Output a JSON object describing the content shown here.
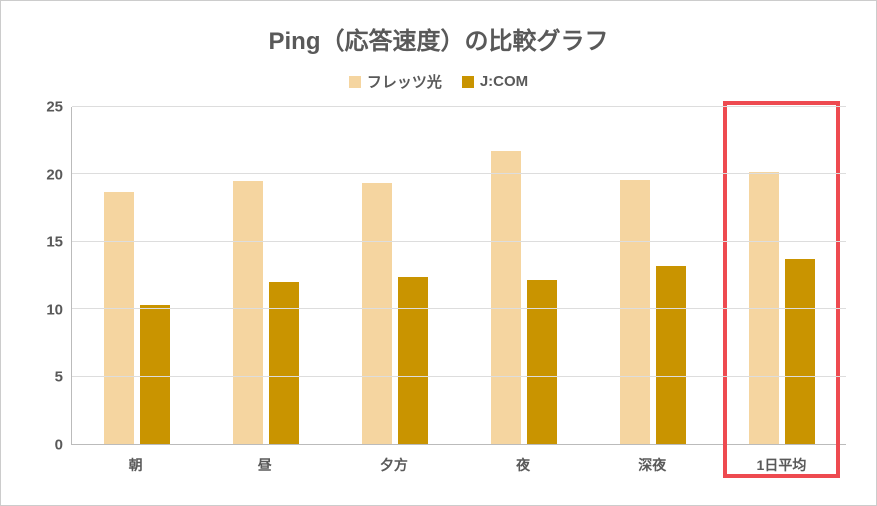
{
  "chart_data": {
    "type": "bar",
    "title": "Ping（応答速度）の比較グラフ",
    "categories": [
      "朝",
      "昼",
      "夕方",
      "夜",
      "深夜",
      "1日平均"
    ],
    "series": [
      {
        "name": "フレッツ光",
        "color": "#f5d5a0",
        "values": [
          18.7,
          19.5,
          19.4,
          21.7,
          19.6,
          20.2
        ]
      },
      {
        "name": "J:COM",
        "color": "#c99400",
        "values": [
          10.3,
          12.0,
          12.4,
          12.2,
          13.2,
          13.7
        ]
      }
    ],
    "ylim": [
      0,
      25
    ],
    "yticks": [
      0,
      5,
      10,
      15,
      20,
      25
    ],
    "highlight_category_index": 5
  }
}
